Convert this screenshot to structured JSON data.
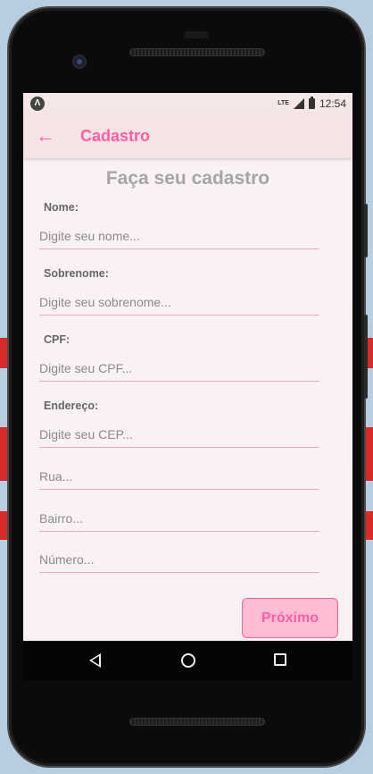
{
  "status_bar": {
    "app_icon_glyph": "Λ",
    "network": "LTE",
    "time": "12:54"
  },
  "app_bar": {
    "back_icon": "arrow-left-icon",
    "title": "Cadastro"
  },
  "form": {
    "heading": "Faça seu cadastro",
    "nome_label": "Nome:",
    "nome_placeholder": "Digite seu nome...",
    "sobrenome_label": "Sobrenome:",
    "sobrenome_placeholder": "Digite seu sobrenome...",
    "cpf_label": "CPF:",
    "cpf_placeholder": "Digite seu CPF...",
    "endereco_label": "Endereço:",
    "cep_placeholder": "Digite seu CEP...",
    "rua_placeholder": "Rua...",
    "bairro_placeholder": "Bairro...",
    "numero_placeholder": "Número...",
    "next_button": "Próximo"
  },
  "colors": {
    "accent": "#ff5fa2",
    "button_fill": "#ffbdd4",
    "screen_background": "#faf1f2",
    "app_bar_background": "#f6e3e5"
  }
}
